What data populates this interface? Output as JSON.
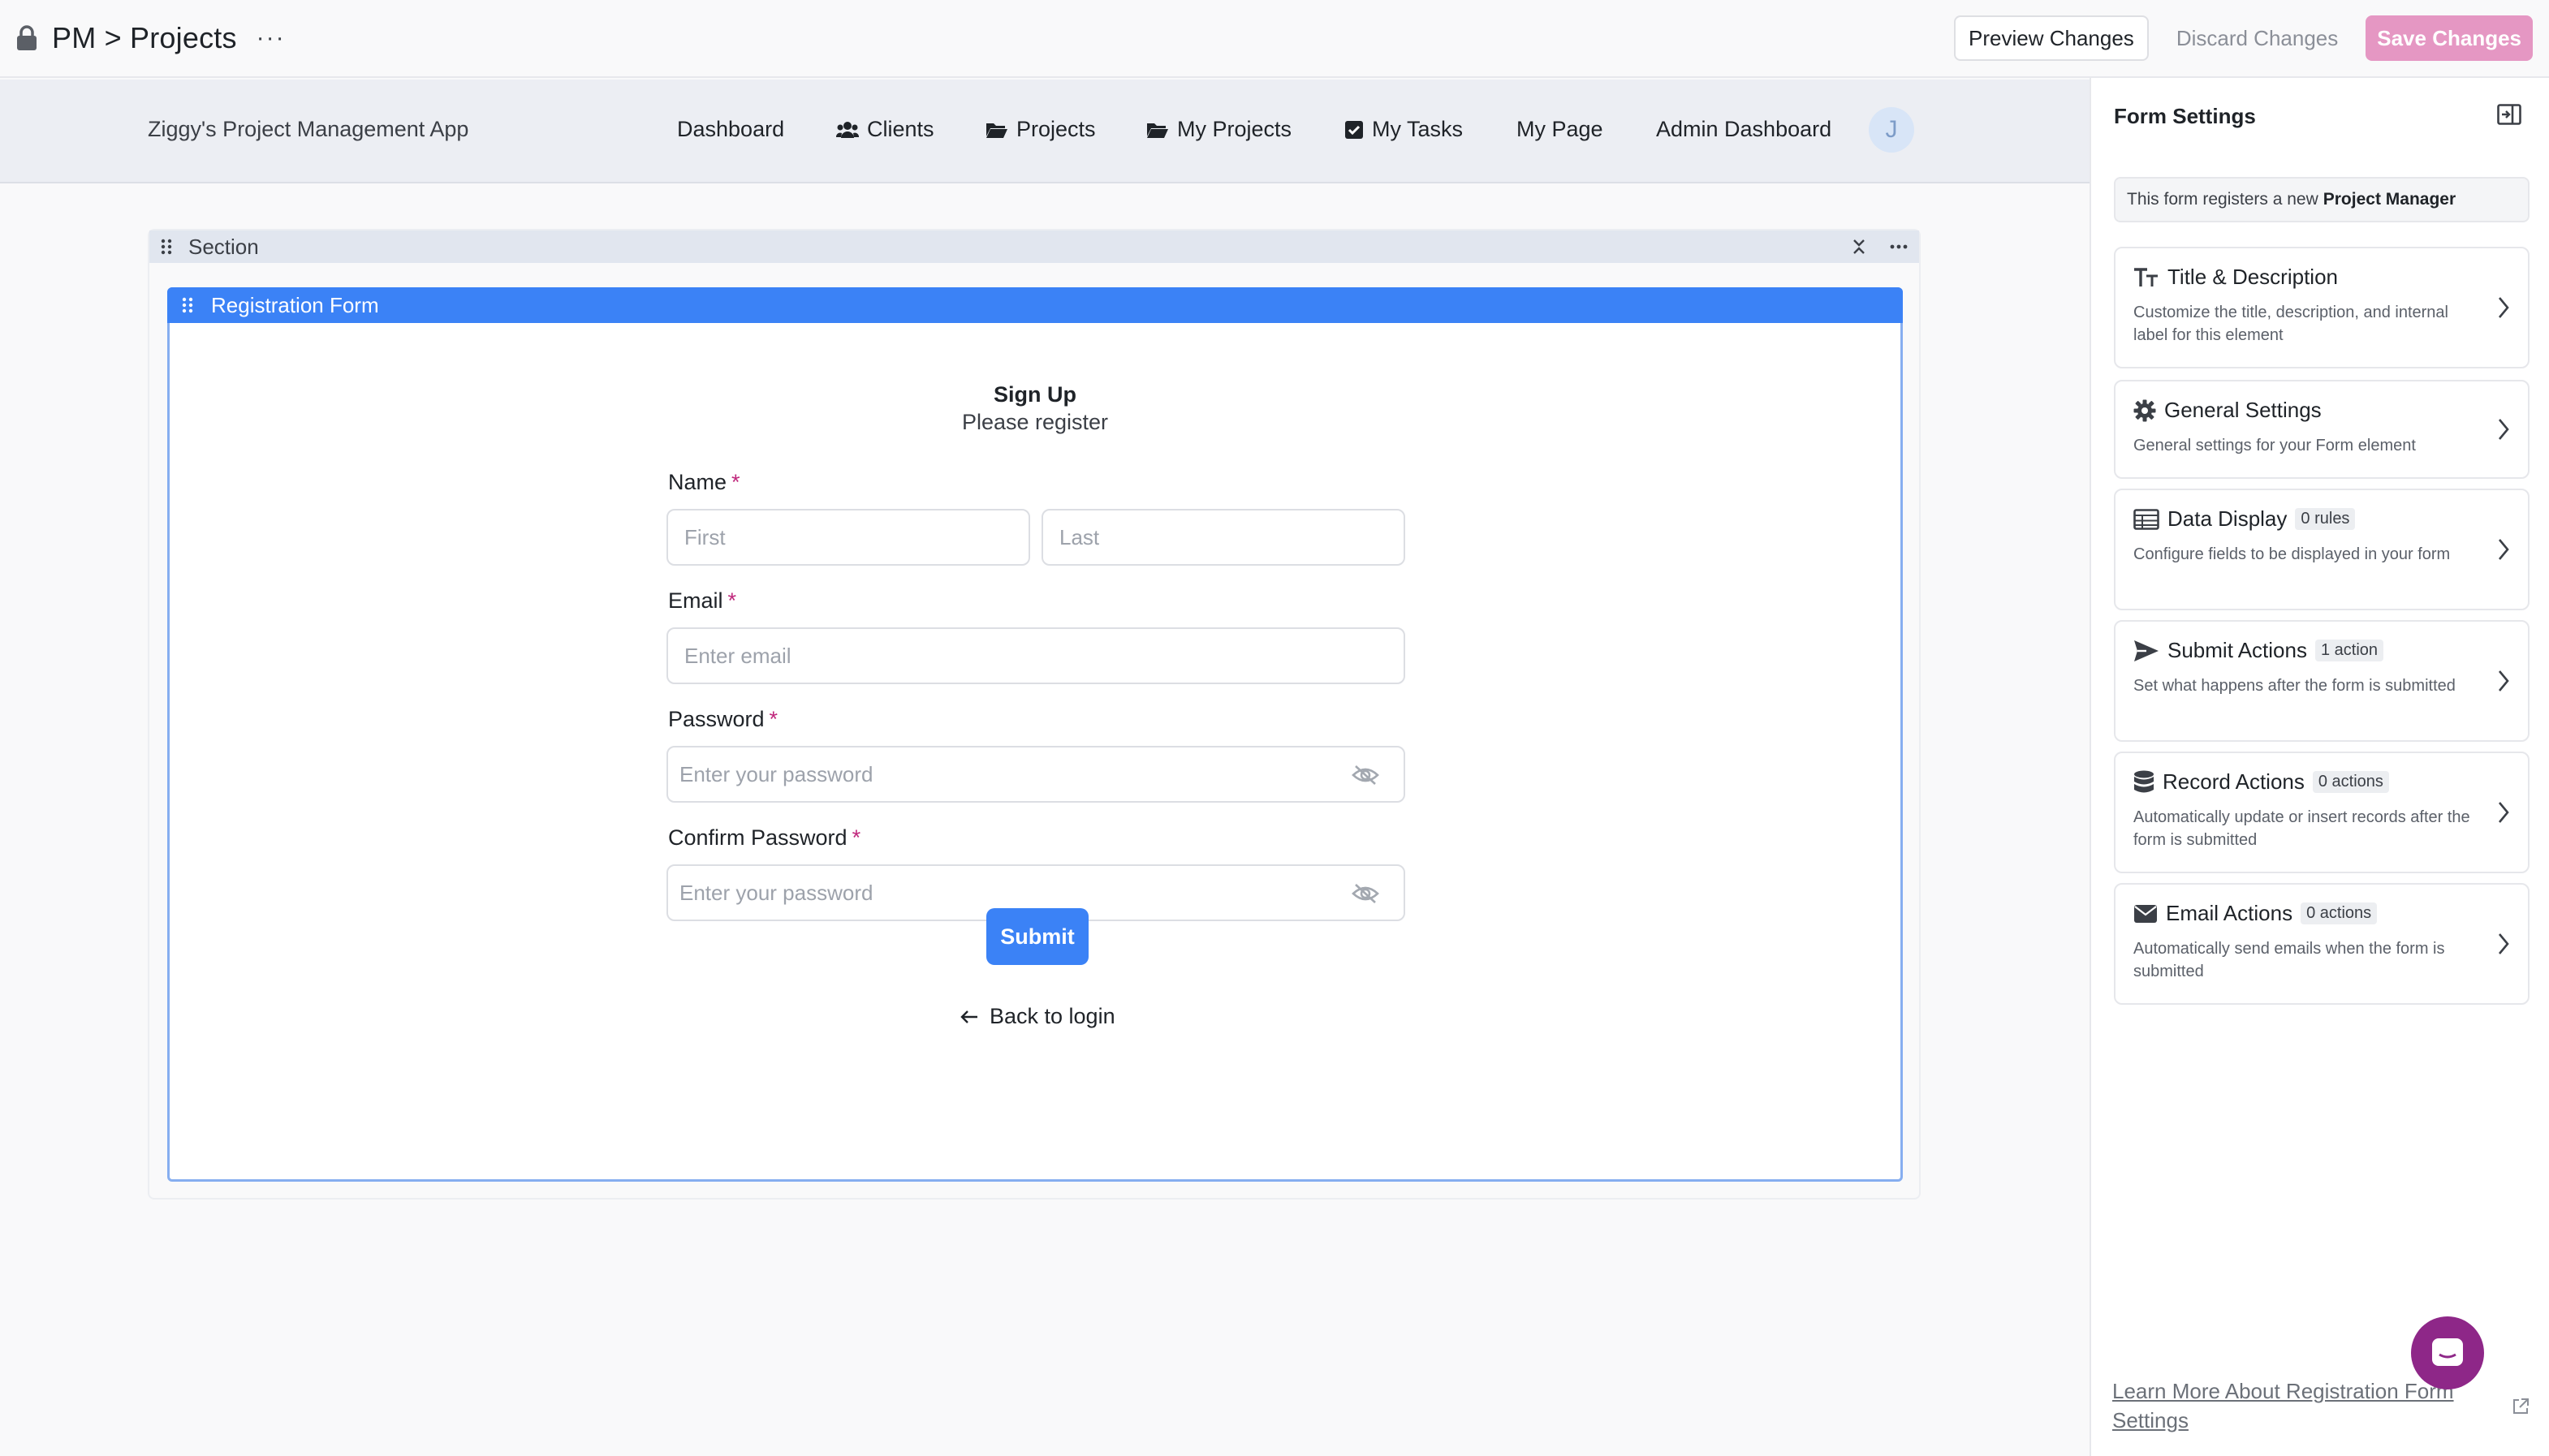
{
  "topbar": {
    "breadcrumb": "PM > Projects",
    "more": "···",
    "preview_label": "Preview Changes",
    "discard_label": "Discard Changes",
    "save_label": "Save Changes"
  },
  "app": {
    "title": "Ziggy's Project Management App",
    "nav": {
      "dashboard": "Dashboard",
      "clients": "Clients",
      "projects": "Projects",
      "my_projects": "My Projects",
      "my_tasks": "My Tasks",
      "my_page": "My Page",
      "admin_dashboard": "Admin Dashboard"
    },
    "avatar_initial": "J"
  },
  "section": {
    "label": "Section",
    "form_label": "Registration Form"
  },
  "form": {
    "title": "Sign Up",
    "subtitle": "Please register",
    "required_mark": "*",
    "name_label": "Name",
    "first_placeholder": "First",
    "last_placeholder": "Last",
    "email_label": "Email",
    "email_placeholder": "Enter email",
    "password_label": "Password",
    "password_placeholder": "Enter your password",
    "confirm_label": "Confirm Password",
    "confirm_placeholder": "Enter your password",
    "submit_label": "Submit",
    "back_label": "Back to login"
  },
  "panel": {
    "title": "Form Settings",
    "info_prefix": "This form registers a new",
    "info_role": "Project Manager",
    "cards": [
      {
        "title": "Title & Description",
        "badge": "",
        "desc": "Customize the title, description, and internal label for this element",
        "icon": "text-icon"
      },
      {
        "title": "General Settings",
        "badge": "",
        "desc": "General settings for your Form element",
        "icon": "gear-icon"
      },
      {
        "title": "Data Display",
        "badge": "0 rules",
        "desc": "Configure fields to be displayed in your form",
        "icon": "table-icon"
      },
      {
        "title": "Submit Actions",
        "badge": "1 action",
        "desc": "Set what happens after the form is submitted",
        "icon": "send-icon"
      },
      {
        "title": "Record Actions",
        "badge": "0 actions",
        "desc": "Automatically update or insert records after the form is submitted",
        "icon": "database-icon"
      },
      {
        "title": "Email Actions",
        "badge": "0 actions",
        "desc": "Automatically send emails when the form is submitted",
        "icon": "envelope-icon"
      }
    ],
    "learn_more": "Learn More About Registration Form Settings"
  },
  "colors": {
    "accent_blue": "#3b82f6",
    "save_pink": "#e597c3",
    "chat_purple": "#8e2788",
    "required_mark": "#c0287c"
  }
}
